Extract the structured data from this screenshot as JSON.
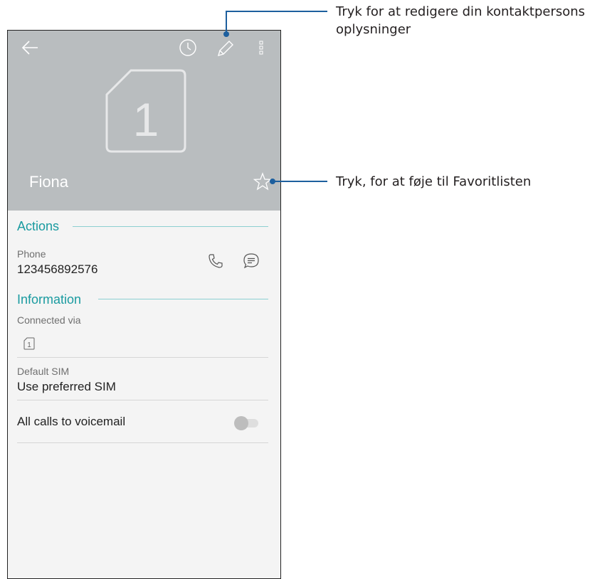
{
  "header": {
    "contact_name": "Fiona",
    "sim_number": "1",
    "colors": {
      "header_bg": "#b9bdbf",
      "accent": "#1a9ba0",
      "callout_line": "#1d5f9e"
    }
  },
  "icons": {
    "back": "arrow-left",
    "history": "clock",
    "edit": "pencil",
    "more": "vertical-dots",
    "favorite": "star-outline",
    "call": "phone-handset",
    "message": "speech-bubble"
  },
  "actions": {
    "title": "Actions",
    "phone_label": "Phone",
    "phone_number": "123456892576"
  },
  "information": {
    "title": "Information",
    "connected_via_label": "Connected via",
    "connected_sim": "1",
    "default_sim_label": "Default SIM",
    "default_sim_value": "Use preferred SIM",
    "voicemail_label": "All calls to voicemail",
    "voicemail_enabled": false
  },
  "callouts": {
    "edit_line1": "Tryk for at redigere din kontaktpersons",
    "edit_line2": "oplysninger",
    "favorite": "Tryk, for at føje til Favoritlisten"
  }
}
